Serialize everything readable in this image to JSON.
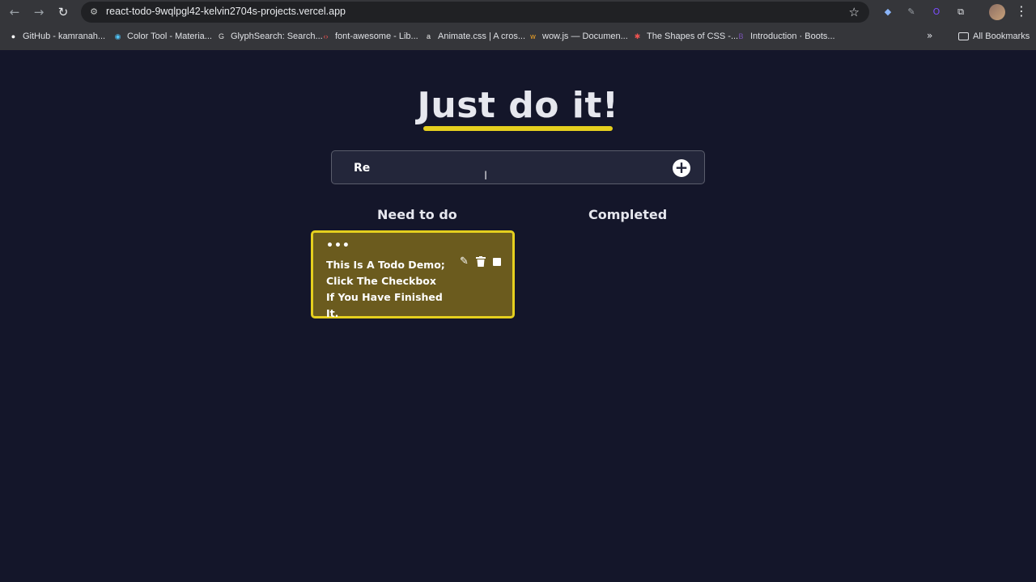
{
  "browser": {
    "url": "react-todo-9wqlpgl42-kelvin2704s-projects.vercel.app",
    "nav": {
      "back_icon": "←",
      "forward_icon": "→",
      "reload_icon": "↻"
    },
    "star_icon": "☆",
    "extensions": [
      {
        "name": "gem-extension-icon",
        "glyph": "◆",
        "color": "#8ab4f8"
      },
      {
        "name": "pencil-extension-icon",
        "glyph": "✎",
        "color": "#9aa0a6"
      },
      {
        "name": "circle-o-extension-icon",
        "glyph": "O",
        "color": "#7c4dff"
      },
      {
        "name": "puzzle-extensions-icon",
        "glyph": "⧉",
        "color": "#e8eaed"
      }
    ],
    "menu_icon": "⋮",
    "bookmarks": [
      {
        "label": "GitHub - kamranah...",
        "glyph": "●",
        "color": "#ffffff"
      },
      {
        "label": "Color Tool - Materia...",
        "glyph": "◉",
        "color": "#4fc3f7"
      },
      {
        "label": "GlyphSearch: Search...",
        "glyph": "G",
        "color": "#e0e0e0"
      },
      {
        "label": "font-awesome - Lib...",
        "glyph": "‹›",
        "color": "#ef5350"
      },
      {
        "label": "Animate.css | A cros...",
        "glyph": "a",
        "color": "#eeeeee"
      },
      {
        "label": "wow.js — Documen...",
        "glyph": "w",
        "color": "#f9a825"
      },
      {
        "label": "The Shapes of CSS -...",
        "glyph": "✱",
        "color": "#ef5350"
      },
      {
        "label": "Introduction · Boots...",
        "glyph": "B",
        "color": "#7952b3"
      }
    ],
    "more_bookmarks": "»",
    "all_bookmarks": "All Bookmarks"
  },
  "app": {
    "title": "Just do it!",
    "input_value": "Re",
    "add_icon": "+",
    "columns": {
      "todo": "Need to do",
      "completed": "Completed"
    },
    "todos": [
      {
        "menu": "•••",
        "text": "This Is A Todo Demo; Click The Checkbox If You Have Finished It.",
        "edit_icon": "✎",
        "delete_icon": "🗑"
      }
    ]
  },
  "colors": {
    "background": "#14162a",
    "accent": "#e5cf1e",
    "card": "#6b5b1e"
  }
}
